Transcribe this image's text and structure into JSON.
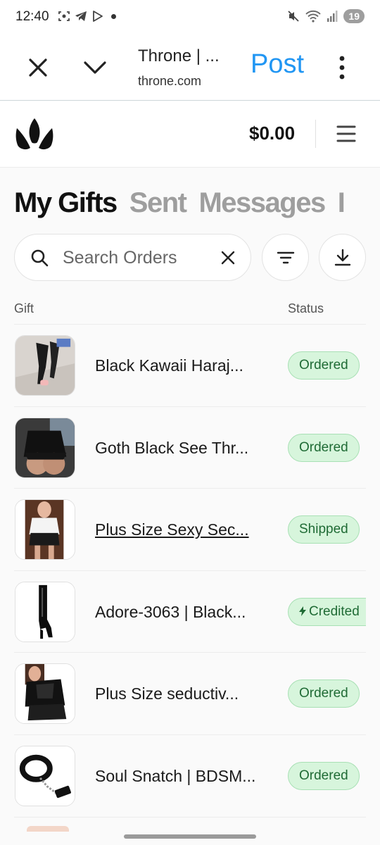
{
  "status_bar": {
    "time": "12:40",
    "battery": "19",
    "icons": [
      "screenshot-icon",
      "telegram-icon",
      "play-store-icon",
      "notification-dot",
      "mute-icon",
      "wifi-icon",
      "signal-icon"
    ]
  },
  "browser": {
    "title": "Throne | ...",
    "url": "throne.com",
    "post_label": "Post",
    "post_color": "#2196f3"
  },
  "header": {
    "balance": "$0.00"
  },
  "tabs": [
    {
      "label": "My Gifts",
      "active": true
    },
    {
      "label": "Sent",
      "active": false
    },
    {
      "label": "Messages",
      "active": false
    },
    {
      "label": "I",
      "active": false
    }
  ],
  "search": {
    "placeholder": "Search Orders",
    "value": ""
  },
  "table": {
    "columns": {
      "gift": "Gift",
      "status": "Status"
    },
    "rows": [
      {
        "name": "Black Kawaii Haraj...",
        "status": "Ordered",
        "underlined": false
      },
      {
        "name": "Goth Black See Thr...",
        "status": "Ordered",
        "underlined": false
      },
      {
        "name": "Plus Size Sexy Sec...",
        "status": "Shipped",
        "underlined": true
      },
      {
        "name": "Adore-3063 | Black...",
        "status": "Credited",
        "underlined": false
      },
      {
        "name": "Plus Size seductiv...",
        "status": "Ordered",
        "underlined": false
      },
      {
        "name": "Soul Snatch | BDSM...",
        "status": "Ordered",
        "underlined": false
      }
    ]
  },
  "colors": {
    "accent": "#2196f3",
    "badge_bg": "#d7f5dc",
    "badge_text": "#1f6b35",
    "inactive_tab": "#9e9e9e"
  }
}
